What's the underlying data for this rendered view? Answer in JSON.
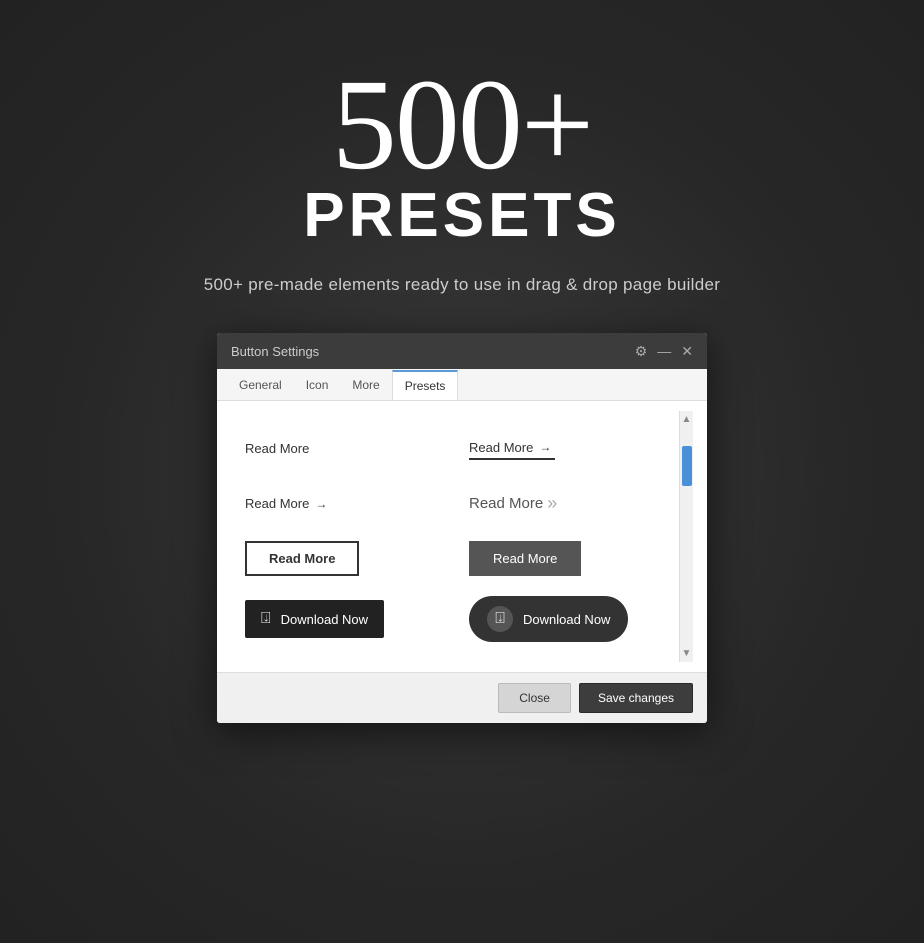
{
  "hero": {
    "big_number": "500+",
    "presets_label": "PRESETS",
    "subtitle": "500+ pre-made elements ready to use in drag & drop page builder"
  },
  "dialog": {
    "title": "Button Settings",
    "tabs": [
      "General",
      "Icon",
      "More",
      "Presets"
    ],
    "active_tab": "Presets",
    "controls": {
      "gear": "⚙",
      "minimize": "—",
      "close": "✕"
    },
    "presets": [
      {
        "id": "plain-text-1",
        "label": "Read More",
        "style": "plain"
      },
      {
        "id": "underline-arrow-1",
        "label": "Read More",
        "style": "underline-arrow"
      },
      {
        "id": "arrow-text-1",
        "label": "Read More",
        "style": "arrow-text"
      },
      {
        "id": "double-arrow-1",
        "label": "Read More",
        "style": "double-arrow"
      },
      {
        "id": "outlined-1",
        "label": "Read More",
        "style": "outlined"
      },
      {
        "id": "dark-outlined-1",
        "label": "Read More",
        "style": "dark-outlined"
      },
      {
        "id": "black-icon-1",
        "label": "Download Now",
        "style": "black-icon"
      },
      {
        "id": "dark-round-icon-1",
        "label": "Download Now",
        "style": "dark-round-icon"
      }
    ],
    "footer": {
      "close_label": "Close",
      "save_label": "Save changes"
    }
  }
}
